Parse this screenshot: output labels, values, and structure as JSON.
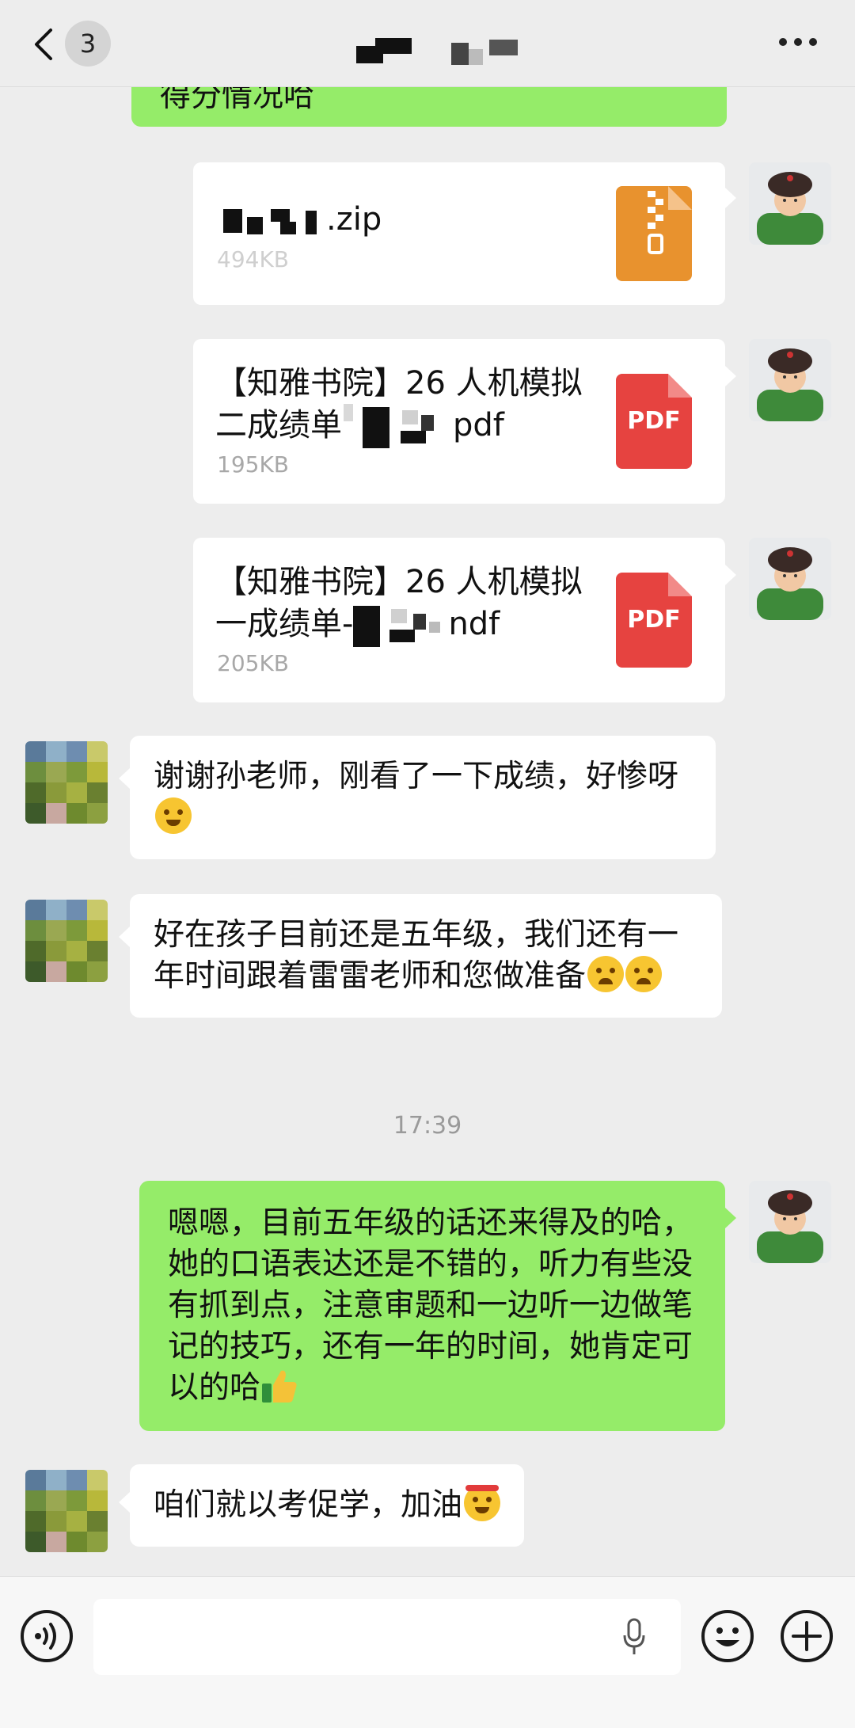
{
  "header": {
    "unread_count": "3",
    "title": "",
    "back_icon": "chevron-left-icon",
    "more_icon": "more-dots-icon"
  },
  "messages": {
    "top_partial_text": "得分情况哈",
    "file_zip": {
      "name_suffix": ".zip",
      "size": "494KB",
      "icon": "zip-file-icon"
    },
    "file_pdf_2": {
      "name_line1": "【知雅书院】26 人机模拟",
      "name_line2_prefix": "二成绩单",
      "name_line2_suffix": "pdf",
      "size": "195KB",
      "icon_label": "PDF"
    },
    "file_pdf_1": {
      "name_line1": "【知雅书院】26 人机模拟",
      "name_line2_prefix": "一成绩单-",
      "name_line2_suffix": "ndf",
      "size": "205KB",
      "icon_label": "PDF"
    },
    "msg_thanks": {
      "text": "谢谢孙老师，刚看了一下成绩，好惨呀",
      "emoji": "facepalm-emoji"
    },
    "msg_fifth_grade": {
      "text": "好在孩子目前还是五年级，我们还有一年时间跟着雷雷老师和您做准备",
      "emoji": "crying-emoji"
    },
    "timestamp": "17:39",
    "msg_reply": {
      "text": "嗯嗯，目前五年级的话还来得及的哈，她的口语表达还是不错的，听力有些没有抓到点，注意审题和一边听一边做笔记的技巧，还有一年的时间，她肯定可以的哈",
      "emoji": "thumbs-up-emoji"
    },
    "msg_cheer": {
      "text": "咱们就以考促学，加油",
      "emoji": "determined-emoji"
    }
  },
  "input_bar": {
    "placeholder": "",
    "voice_icon": "voice-icon",
    "mic_icon": "microphone-icon",
    "emoji_icon": "emoji-icon",
    "plus_icon": "plus-icon"
  },
  "colors": {
    "green_bubble": "#95ec69",
    "background": "#ededed",
    "pdf_red": "#e64340",
    "zip_orange": "#e8922e"
  }
}
